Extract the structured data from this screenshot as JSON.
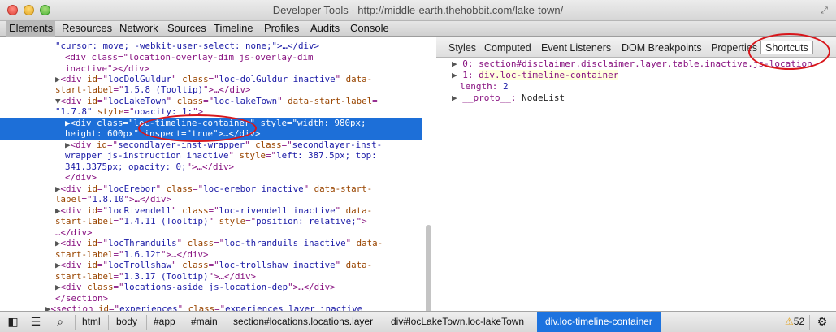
{
  "window": {
    "title": "Developer Tools - http://middle-earth.thehobbit.com/lake-town/"
  },
  "toolbar": {
    "tabs": [
      {
        "label": "Elements"
      },
      {
        "label": "Resources"
      },
      {
        "label": "Network"
      },
      {
        "label": "Sources"
      },
      {
        "label": "Timeline"
      },
      {
        "label": "Profiles"
      },
      {
        "label": "Audits"
      },
      {
        "label": "Console"
      }
    ]
  },
  "sidebar": {
    "tabs": [
      {
        "label": "Styles"
      },
      {
        "label": "Computed"
      },
      {
        "label": "Event Listeners"
      },
      {
        "label": "DOM Breakpoints"
      },
      {
        "label": "Properties"
      },
      {
        "label": "Shortcuts"
      }
    ],
    "console": {
      "row0": {
        "index": "0:",
        "value": "section#disclaimer.disclaimer.layer.table.inactive.js-location"
      },
      "row1": {
        "index": "1:",
        "value": "div.loc-timeline-container"
      },
      "row2": {
        "key": "length:",
        "value": "2"
      },
      "row3": {
        "key": "__proto__:",
        "value": "NodeList"
      }
    }
  },
  "dom": {
    "l0": "\"cursor: move; -webkit-user-select: none;\">…</div>",
    "l1": "<div class=\"location-overlay-dim js-overlay-dim",
    "l2": "inactive\"></div>",
    "l3a": "<div ",
    "l3b": "id",
    "l3c": "=\"",
    "l3d": "locDolGuldur",
    "l3e": "\" ",
    "l3f": "class",
    "l3g": "=\"",
    "l3h": "loc-dolGuldur inactive",
    "l3i": "\" ",
    "l3j": "data-",
    "l4a": "start-label",
    "l4b": "=\"",
    "l4c": "1.5.8 (Tooltip)",
    "l4d": "\">…</div>",
    "l5a": "<div ",
    "l5b": "id",
    "l5c": "=\"",
    "l5d": "locLakeTown",
    "l5e": "\" ",
    "l5f": "class",
    "l5g": "=\"",
    "l5h": "loc-lakeTown",
    "l5i": "\" ",
    "l5j": "data-start-label",
    "l5k": "=",
    "l6a": "\"1.7.8\"",
    "l6b": " style",
    "l6c": "=\"",
    "l6d": "opacity: 1;",
    "l6e": "\">",
    "l7": "<div class=\"loc-timeline-container\" style=\"width: 980px;",
    "l8": "height: 600px\" inspect=\"true\">…</div>",
    "l9a": "<div ",
    "l9b": "id",
    "l9c": "=\"",
    "l9d": "secondlayer-inst-wrapper",
    "l9e": "\" ",
    "l9f": "class",
    "l9g": "=\"",
    "l9h": "secondlayer-inst-",
    "l10a": "wrapper js-instruction inactive",
    "l10b": "\" ",
    "l10c": "style",
    "l10d": "=\"",
    "l10e": "left: 387.5px; top:",
    "l11a": "341.3375px; opacity: 0;",
    "l11b": "\">…</div>",
    "l12": "</div>",
    "l13a": "<div ",
    "l13b": "id",
    "l13c": "=\"",
    "l13d": "locErebor",
    "l13e": "\" ",
    "l13f": "class",
    "l13g": "=\"",
    "l13h": "loc-erebor inactive",
    "l13i": "\" ",
    "l13j": "data-start-",
    "l14a": "label",
    "l14b": "=\"",
    "l14c": "1.8.10",
    "l14d": "\">…</div>",
    "l15a": "<div ",
    "l15b": "id",
    "l15c": "=\"",
    "l15d": "locRivendell",
    "l15e": "\" ",
    "l15f": "class",
    "l15g": "=\"",
    "l15h": "loc-rivendell inactive",
    "l15i": "\" ",
    "l15j": "data-",
    "l16a": "start-label",
    "l16b": "=\"",
    "l16c": "1.4.11 (Tooltip)",
    "l16d": "\" ",
    "l16e": "style",
    "l16f": "=\"",
    "l16g": "position: relative;",
    "l16h": "\">",
    "l17": "…</div>",
    "l18a": "<div ",
    "l18b": "id",
    "l18c": "=\"",
    "l18d": "locThranduils",
    "l18e": "\" ",
    "l18f": "class",
    "l18g": "=\"",
    "l18h": "loc-thranduils inactive",
    "l18i": "\" ",
    "l18j": "data-",
    "l19a": "start-label",
    "l19b": "=\"",
    "l19c": "1.6.12t",
    "l19d": "\">…</div>",
    "l20a": "<div ",
    "l20b": "id",
    "l20c": "=\"",
    "l20d": "locTrollshaw",
    "l20e": "\" ",
    "l20f": "class",
    "l20g": "=\"",
    "l20h": "loc-trollshaw inactive",
    "l20i": "\" ",
    "l20j": "data-",
    "l21a": "start-label",
    "l21b": "=\"",
    "l21c": "1.3.17 (Tooltip)",
    "l21d": "\">…</div>",
    "l22a": "<div ",
    "l22b": "class",
    "l22c": "=\"",
    "l22d": "locations-aside js-location-dep",
    "l22e": "\">…</div>",
    "l23": "</section>",
    "l24a": "<section ",
    "l24b": "id",
    "l24c": "=\"",
    "l24d": "experiences",
    "l24e": "\" ",
    "l24f": "class",
    "l24g": "=\"",
    "l24h": "experiences layer inactive"
  },
  "statusbar": {
    "crumbs": [
      {
        "label": "html"
      },
      {
        "label": "body"
      },
      {
        "label": "#app"
      },
      {
        "label": "#main"
      },
      {
        "label": "section#locations.locations.layer"
      },
      {
        "label": "div#locLakeTown.loc-lakeTown"
      },
      {
        "label": "div.loc-timeline-container"
      }
    ],
    "warnings": "52"
  },
  "colors": {
    "selection": "#1d6fd8",
    "annotation": "#d8161b",
    "tag": "#881280",
    "attr": "#994500",
    "value": "#1a1aa6"
  }
}
